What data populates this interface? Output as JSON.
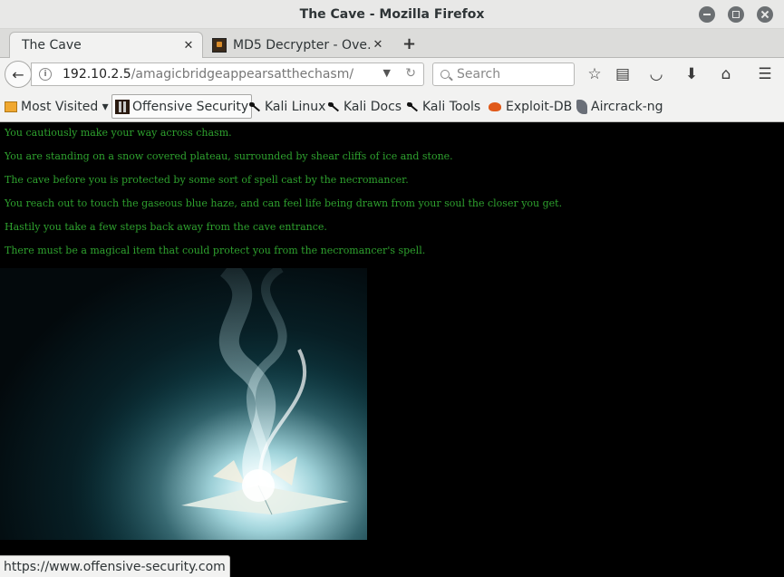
{
  "window": {
    "title": "The Cave - Mozilla Firefox"
  },
  "tabs": [
    {
      "label": "The Cave",
      "active": true
    },
    {
      "label": "MD5 Decrypter - Ove…",
      "active": false
    }
  ],
  "newtab": {
    "label": "+"
  },
  "navbar": {
    "url_host": "192.10.2.5",
    "url_path": "/amagicbridgeappearsatthechasm/",
    "search_placeholder": "Search"
  },
  "bookmarks": [
    {
      "label": "Most Visited ▾",
      "icon": "folder-icon"
    },
    {
      "label": "Offensive Security",
      "icon": "offsec-icon"
    },
    {
      "label": "Kali Linux",
      "icon": "kali-icon"
    },
    {
      "label": "Kali Docs",
      "icon": "kali-icon"
    },
    {
      "label": "Kali Tools",
      "icon": "kali-icon"
    },
    {
      "label": "Exploit-DB",
      "icon": "exploitdb-icon"
    },
    {
      "label": "Aircrack-ng",
      "icon": "aircrack-icon"
    }
  ],
  "page": {
    "text_color": "#2ea12e",
    "lines": [
      "You cautiously make your way across chasm.",
      "You are standing on a snow covered plateau, surrounded by shear cliffs of ice and stone.",
      "The cave before you is protected by some sort of spell cast by the necromancer.",
      "You reach out to touch the gaseous blue haze, and can feel life being drawn from your soul the closer you get.",
      "Hastily you take a few steps back away from the cave entrance.",
      "There must be a magical item that could protect you from the necromancer's spell."
    ]
  },
  "status": {
    "text": "https://www.offensive-security.com"
  }
}
